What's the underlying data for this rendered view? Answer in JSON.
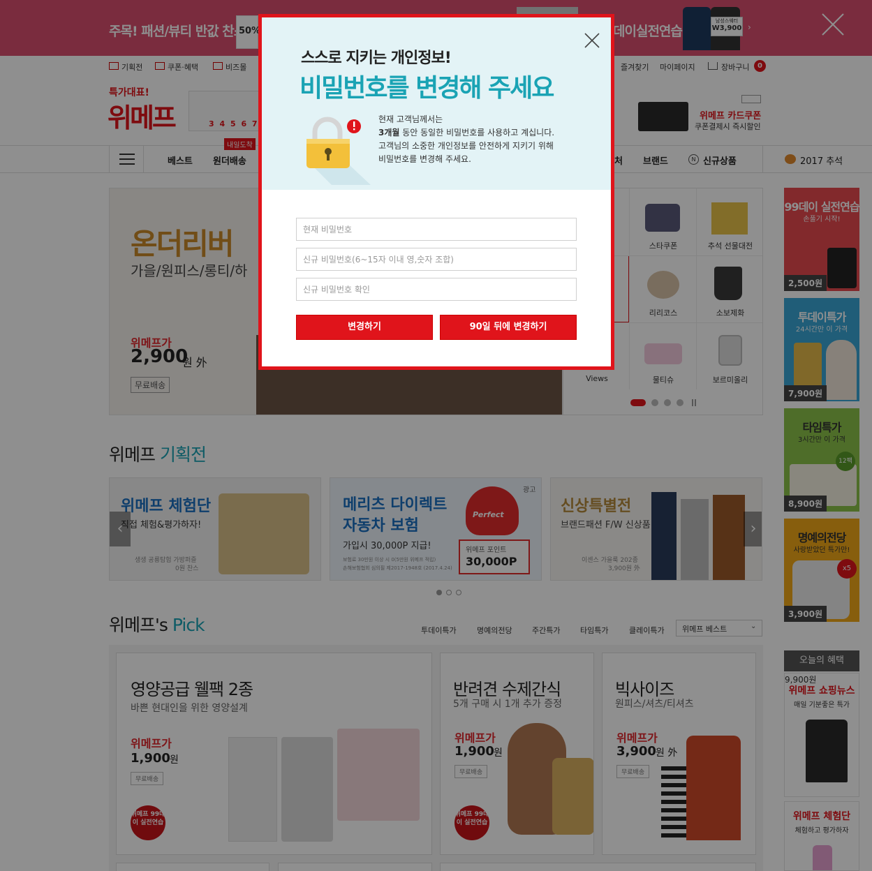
{
  "banner": {
    "left_text": "주목! 패션/뷰티 반값 찬스",
    "sale_label": "50%",
    "right_text": "데이실전연습",
    "man_label": "남성스웨터",
    "man_price": "W3,900"
  },
  "gnb": {
    "links": [
      "기획전",
      "쿠폰·혜택",
      "비즈몰"
    ],
    "right_links": [
      "즐겨찾기",
      "마이페이지",
      "장바구니"
    ],
    "cart_count": "0",
    "logo_top": "특가대표!",
    "logo": "위메프",
    "date_nums": "3 4 5 6 7 8",
    "card_title": "위메프 카드쿠폰",
    "card_sub": "쿠폰결제시 즉시할인"
  },
  "nav": {
    "items": [
      "베스트",
      "원더배송"
    ],
    "badge": "내일도착",
    "right_items": [
      "브랜드",
      "신규상품"
    ],
    "partial": "처",
    "chuseok": "2017 추석"
  },
  "hero": {
    "title": "온더리버",
    "subtitle": "가을/원피스/롱티/하",
    "price_label": "위메프가",
    "price": "2,900",
    "price_unit": "원 外",
    "free_ship": "무료배송"
  },
  "categories": {
    "items": [
      {
        "label": "스타쿠폰",
        "icon": "cosmetics-icon"
      },
      {
        "label": "추석 선물대전",
        "icon": "giftbox-icon"
      },
      {
        "label": "리리코스",
        "icon": "cushion-icon"
      },
      {
        "label": "소보제화",
        "icon": "shoes-icon"
      },
      {
        "label": "Views",
        "icon": "views-icon"
      },
      {
        "label": "물티슈",
        "icon": "wipes-icon"
      },
      {
        "label": "보르미올리",
        "icon": "jar-icon"
      }
    ]
  },
  "special": {
    "title_a": "위메프",
    "title_b": "기획전",
    "cards": [
      {
        "title": "위메프 체험단",
        "sub": "직접 체험&평가하자!",
        "note1": "생생 공룡탐험 가방퍼즐",
        "note2": "0원 찬스"
      },
      {
        "title1": "메리츠 다이렉트",
        "title2": "자동차 보험",
        "sub": "가입시 30,000P 지급!",
        "note1": "보험료 30만원 이상 시 0(5만원 위메프 적립)",
        "note2": "손해보험협회 심의필 제2017-1948호 (2017.4.24)",
        "ad": "광고",
        "point_label": "위메프 포인트",
        "point": "30,000P",
        "sticker": "Perfect"
      },
      {
        "title": "신상특별전",
        "sub": "브랜드패션 F/W 신상품",
        "note1": "이센스 가을룩 202종",
        "note2": "3,900원 外"
      }
    ]
  },
  "pick": {
    "title_a": "위메프's",
    "title_b": "Pick",
    "tabs": [
      "투데이특가",
      "명예의전당",
      "주간특가",
      "타임특가",
      "클레이특가"
    ],
    "select": "위메프 베스트",
    "cards": [
      {
        "title": "영양공급 웰팩 2종",
        "sub": "바쁜 현대인을 위한 영양설계",
        "price_label": "위메프가",
        "price": "1,900",
        "unit": "원",
        "free": "무료배송",
        "badge": "위메프 99데이 실전연습"
      },
      {
        "title": "반려견 수제간식",
        "sub": "5개 구매 시 1개 추가 증정",
        "price_label": "위메프가",
        "price": "1,900",
        "unit": "원",
        "free": "무료배송",
        "badge": "위메프 99데이 실전연습"
      },
      {
        "title": "빅사이즈",
        "sub": "원피스/셔츠/티셔츠",
        "price_label": "위메프가",
        "price": "3,900",
        "unit": "원 外",
        "free": "무료배송"
      }
    ]
  },
  "sidebar": {
    "items": [
      {
        "title": "99데이 실전연습",
        "sub": "손풀기 시작!",
        "price": "2,500원",
        "bg": "#e84a4f"
      },
      {
        "title": "투데이특가",
        "sub": "24시간만 이 가격",
        "price": "7,900원",
        "bg": "#3aa7d6"
      },
      {
        "title": "타임특가",
        "sub": "3시간만 이 가격",
        "price": "8,900원",
        "bg": "#8bc34a",
        "badge": "12팩"
      },
      {
        "title": "명예의전당",
        "sub": "사랑받았던 특가만!",
        "price": "3,900원",
        "bg": "#f0a818",
        "badge": "x5"
      }
    ],
    "benefit_header": "오늘의 혜택",
    "benefits": [
      {
        "title": "위메프 쇼핑뉴스",
        "sub": "매일 기분좋은 특가",
        "price": "9,900원"
      },
      {
        "title": "위메프 체험단",
        "sub": "체험하고 평가하자"
      }
    ]
  },
  "modal": {
    "heading1": "스스로 지키는 개인정보!",
    "heading2": "비밀번호를 변경해 주세요",
    "line1": "현재 고객님께서는",
    "line2_bold": "3개월",
    "line2_rest": " 동안 동일한 비밀번호를 사용하고 계십니다.",
    "line3": "고객님의 소중한 개인정보를 안전하게 지키기 위해",
    "line4": "비밀번호를 변경해 주세요.",
    "placeholder_current": "현재 비밀번호",
    "placeholder_new": "신규 비밀번호(6~15자 이내 영,숫자 조합)",
    "placeholder_confirm": "신규 비밀번호 확인",
    "btn_change": "변경하기",
    "btn_later": "90일 뒤에 변경하기"
  },
  "colors": {
    "accent": "#e0141b",
    "teal": "#1aa3b4",
    "banner": "#d94f6f"
  }
}
